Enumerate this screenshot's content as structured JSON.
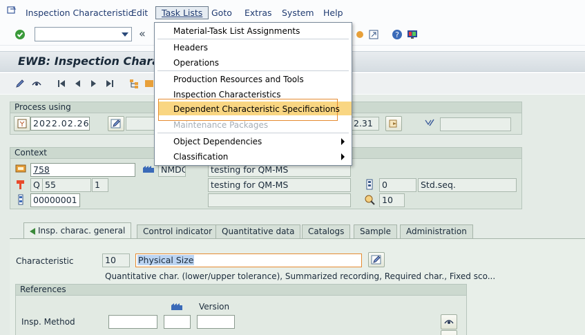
{
  "menubar": {
    "items": [
      "Inspection Characteristic",
      "Edit",
      "Task Lists",
      "Goto",
      "Extras",
      "System",
      "Help"
    ]
  },
  "title": "EWB: Inspection Chara",
  "process_using": {
    "header": "Process using",
    "date": "2022.02.26",
    "date_right": "2.31"
  },
  "context": {
    "header": "Context",
    "row1": {
      "material": "758",
      "plant": "NMDC",
      "desc": "testing for QM-MS"
    },
    "row2": {
      "type": "Q",
      "group": "55",
      "counter": "1",
      "desc": "testing for QM-MS",
      "seq": "0",
      "seq_label": "Std.seq."
    },
    "row3": {
      "op": "00000001",
      "char_count": "10"
    }
  },
  "tabs": [
    "Insp. charac. general",
    "Control indicator",
    "Quantitative data",
    "Catalogs",
    "Sample",
    "Administration"
  ],
  "characteristic": {
    "label": "Characteristic",
    "number": "10",
    "text": "Physical Size",
    "description": "Quantitative char. (lower/upper tolerance), Summarized recording, Required char., Fixed sco..."
  },
  "references": {
    "header": "References",
    "version_label": "Version",
    "insp_method_label": "Insp. Method"
  },
  "dropdown": {
    "items": [
      {
        "label": "Material-Task List Assignments",
        "disabled": false
      },
      {
        "label": "Headers",
        "disabled": false
      },
      {
        "label": "Operations",
        "disabled": false
      },
      {
        "label": "Production Resources and Tools",
        "disabled": false
      },
      {
        "label": "Inspection Characteristics",
        "disabled": false
      },
      {
        "label": "Dependent Characteristic Specifications",
        "disabled": false,
        "highlighted": true
      },
      {
        "label": "Maintenance Packages",
        "disabled": true
      },
      {
        "label": "Object Dependencies",
        "disabled": false,
        "submenu": true
      },
      {
        "label": "Classification",
        "disabled": false,
        "submenu": true
      }
    ]
  },
  "colors": {
    "highlight": "#f9d682",
    "highlight_border": "#e58a30",
    "field_highlight": "#fde8a0"
  }
}
